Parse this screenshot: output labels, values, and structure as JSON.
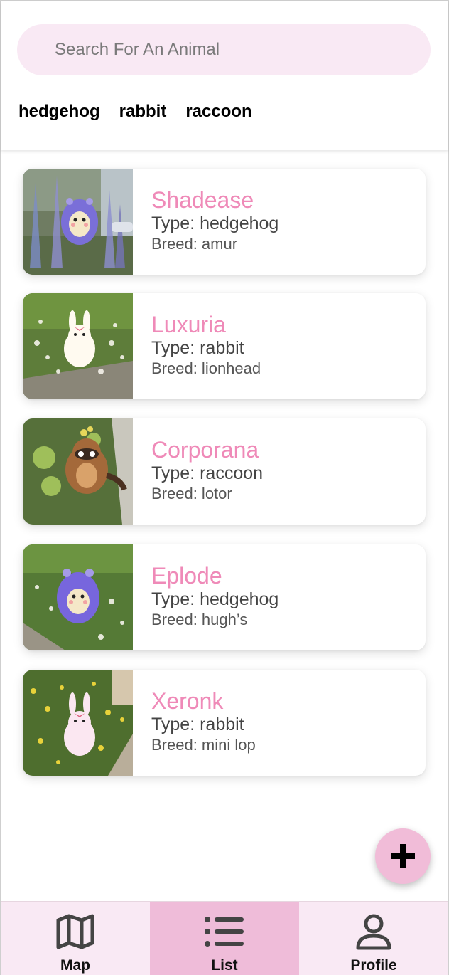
{
  "search": {
    "placeholder": "Search For An Animal",
    "value": ""
  },
  "filters": [
    "hedgehog",
    "rabbit",
    "raccoon"
  ],
  "animals": [
    {
      "name": "Shadease",
      "type": "Type: hedgehog",
      "breed": "Breed: amur"
    },
    {
      "name": "Luxuria",
      "type": "Type: rabbit",
      "breed": "Breed: lionhead"
    },
    {
      "name": "Corporana",
      "type": "Type: raccoon",
      "breed": "Breed: lotor"
    },
    {
      "name": "Eplode",
      "type": "Type: hedgehog",
      "breed": "Breed: hugh’s"
    },
    {
      "name": "Xeronk",
      "type": "Type: rabbit",
      "breed": "Breed: mini lop"
    }
  ],
  "fab": {
    "icon": "plus-icon"
  },
  "nav": [
    {
      "label": "Map",
      "icon": "map-icon"
    },
    {
      "label": "List",
      "icon": "list-icon",
      "active": true
    },
    {
      "label": "Profile",
      "icon": "profile-icon"
    }
  ],
  "colors": {
    "accent_pink": "#ef8ab8",
    "search_bg": "#f9e9f4",
    "nav_bg": "#f9e9f4",
    "nav_active": "#efbcd9",
    "fab_bg": "#f1bcd8"
  }
}
